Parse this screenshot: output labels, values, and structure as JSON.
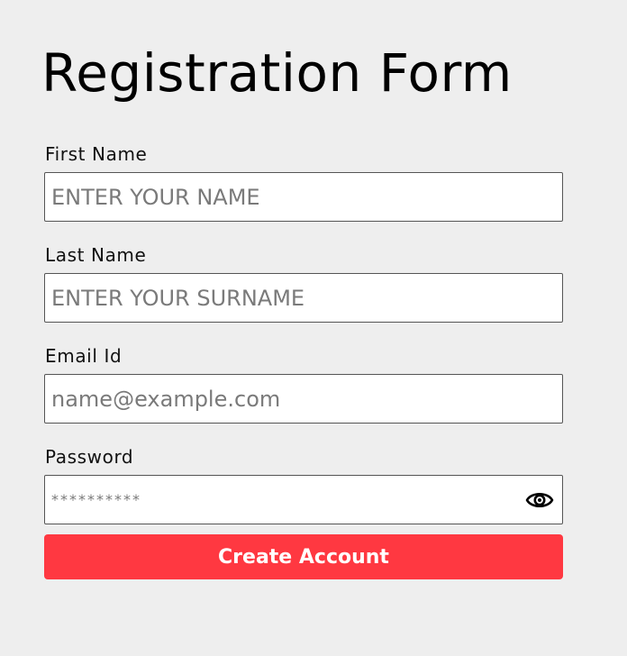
{
  "form": {
    "title": "Registration Form",
    "first_name": {
      "label": "First Name",
      "placeholder": "ENTER YOUR NAME",
      "value": ""
    },
    "last_name": {
      "label": "Last Name",
      "placeholder": "ENTER YOUR SURNAME",
      "value": ""
    },
    "email": {
      "label": "Email Id",
      "placeholder": "name@example.com",
      "value": ""
    },
    "password": {
      "label": "Password",
      "placeholder": "**********",
      "value": "",
      "toggle_icon": "eye-icon"
    },
    "submit_label": "Create Account"
  },
  "colors": {
    "background": "#eeeeee",
    "accent": "#ff3841",
    "field_border": "#555555"
  }
}
